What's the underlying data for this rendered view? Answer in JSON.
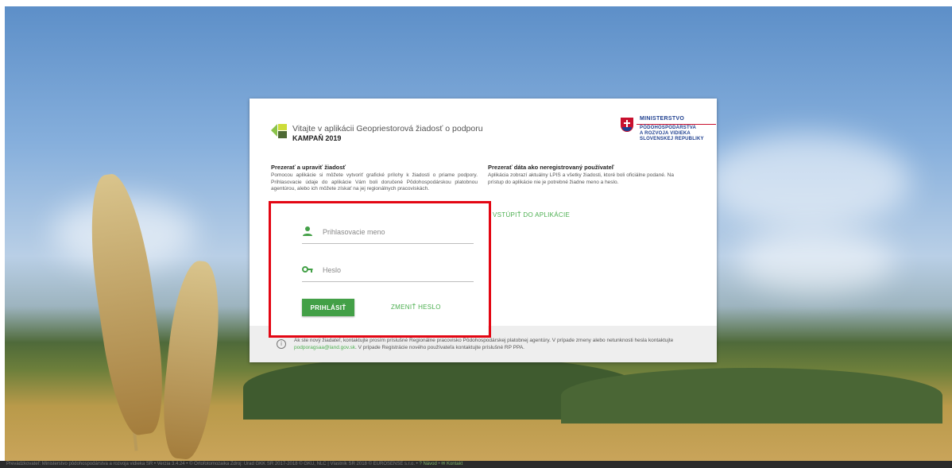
{
  "app": {
    "title": "Vitajte v aplikácii Geopriestorová žiadosť o podporu",
    "campaign": "KAMPAŇ 2019"
  },
  "ministry": {
    "lines": [
      "MINISTERSTVO",
      "PÔDOHOSPODÁRSTVA",
      "A ROZVOJA VIDIEKA",
      "SLOVENSKEJ REPUBLIKY"
    ]
  },
  "left_column": {
    "heading": "Prezerať a upraviť žiadosť",
    "text": "Pomocou aplikácie si môžete vytvoriť grafické prílohy k žiadosti o priame podpory. Prihlasovacie údaje do aplikácie Vám boli doručené Pôdohospodárskou platobnou agentúrou, alebo ich môžete získať na jej regionálnych pracoviskách."
  },
  "right_column": {
    "heading": "Prezerať dáta ako neregistrovaný používateľ",
    "text": "Aplikácia zobrazí aktuálny LPIS a všetky žiadosti, ktoré boli oficiálne podané. Na prístup do aplikácie nie je potrebné žiadne meno a heslo.",
    "link": "VSTÚPIŤ DO APLIKÁCIE"
  },
  "login": {
    "username_placeholder": "Prihlasovacie meno",
    "password_placeholder": "Heslo",
    "login_button": "PRIHLÁSIŤ",
    "change_password": "ZMENIŤ HESLO",
    "username_icon": "person-icon",
    "password_icon": "key-icon"
  },
  "info": {
    "icon": "info-icon",
    "text_before": "Ak ste nový žiadateľ, kontaktujte prosím príslušné Regionálne pracovisko Pôdohospodárskej platobnej agentúry. V prípade zmeny alebo netunknosti hesla kontaktujte ",
    "email": "podporagsaa@land.gov.sk",
    "text_after": ". V prípade Registrácie nového používateľa kontaktujte príslušné RP PPA."
  },
  "footer": {
    "text": "Prevádzkovateľ: Ministerstvo pôdohospodárstva a rozvoja vidieka SR • Verzia 3.4.24 • © Ortofotomozaika Zdroj: Úrad GKK SR 2017-2018 © GKÚ, NLC | Vlastník SR 2018 © EUROSENSE s.r.o. •",
    "help": "Návod",
    "contact": "Kontakt"
  },
  "colors": {
    "accent": "#43a047",
    "highlight": "#e30613",
    "ministry_blue": "#1e3f8f",
    "ministry_red": "#c8102e"
  }
}
